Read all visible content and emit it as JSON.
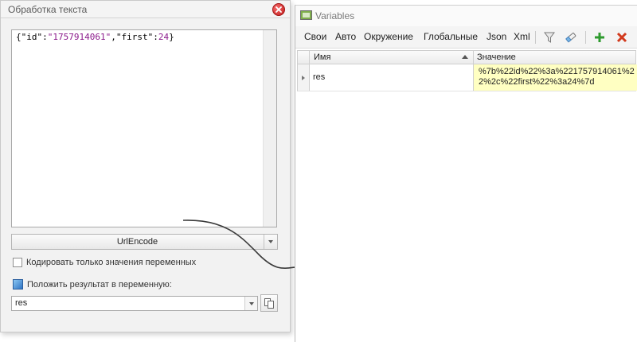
{
  "left_panel": {
    "title": "Обработка текста",
    "editor": {
      "tokens": [
        {
          "t": "{",
          "c": "tok-brace"
        },
        {
          "t": "\"id\"",
          "c": "tok-key"
        },
        {
          "t": ":",
          "c": "tok-punct"
        },
        {
          "t": "\"1757914061\"",
          "c": "tok-str"
        },
        {
          "t": ",",
          "c": "tok-punct"
        },
        {
          "t": "\"first\"",
          "c": "tok-key"
        },
        {
          "t": ":",
          "c": "tok-punct"
        },
        {
          "t": "24",
          "c": "tok-num"
        },
        {
          "t": "}",
          "c": "tok-brace"
        }
      ]
    },
    "operation_select": {
      "value": "UrlEncode"
    },
    "encode_only_vars": {
      "label": "Кодировать только значения переменных",
      "checked": false
    },
    "put_result": {
      "label": "Положить результат в переменную:"
    },
    "result_variable": {
      "value": "res"
    }
  },
  "right_panel": {
    "title": "Variables",
    "tabs": [
      {
        "label": "Свои",
        "active": true
      },
      {
        "label": "Авто",
        "active": false
      },
      {
        "label": "Окружение",
        "active": false
      },
      {
        "label": "Глобальные",
        "active": false
      },
      {
        "label": "Json",
        "active": false
      },
      {
        "label": "Xml",
        "active": false
      }
    ],
    "toolbar_icons": [
      "filter-icon",
      "eraser-icon",
      "add-icon",
      "delete-icon"
    ],
    "columns": {
      "name": "Имя",
      "value": "Значение"
    },
    "rows": [
      {
        "name": "res",
        "value": "%7b%22id%22%3a%221757914061%22%2c%22first%22%3a24%7d"
      }
    ]
  },
  "colors": {
    "active_tab": "#f7c94b",
    "value_cell": "#ffffc2",
    "close_button": "#c21d1d",
    "add_icon": "#2e9a2e",
    "delete_icon": "#d23a1d"
  }
}
